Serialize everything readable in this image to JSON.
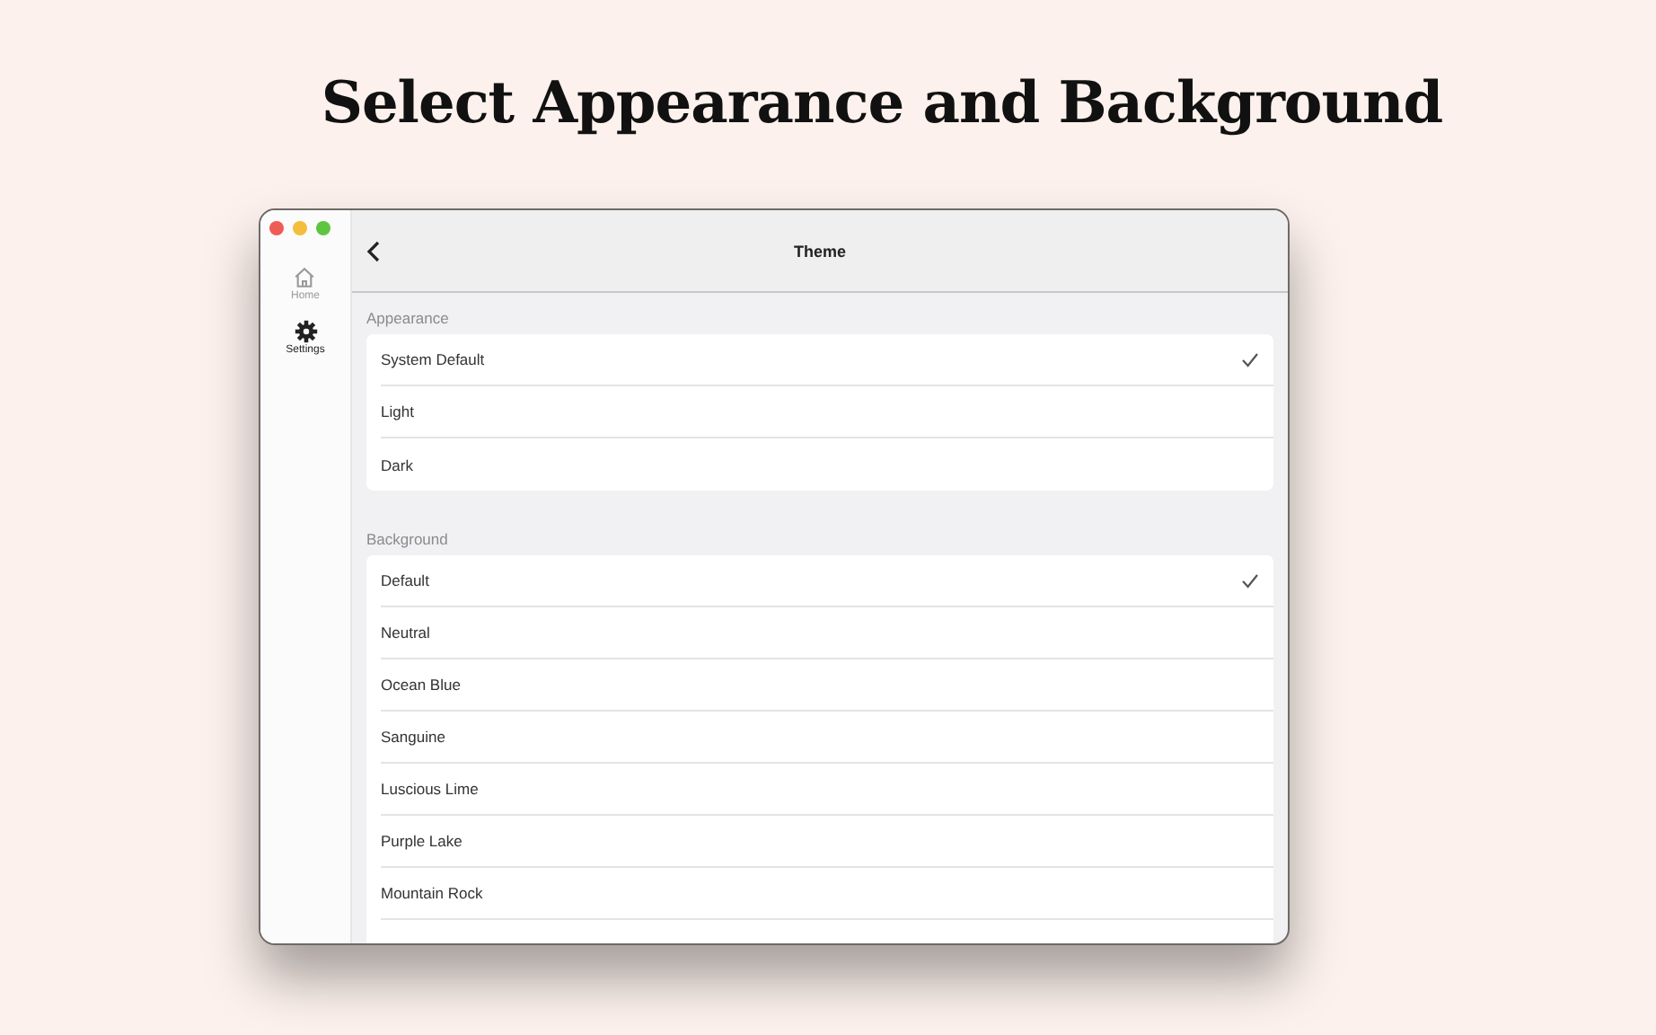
{
  "headline": "Select Appearance and Background",
  "sidebar": {
    "items": [
      {
        "label": "Home",
        "selected": false,
        "kind": "home"
      },
      {
        "label": "Settings",
        "selected": true,
        "kind": "gear"
      }
    ]
  },
  "header": {
    "title": "Theme"
  },
  "sections": [
    {
      "title": "Appearance",
      "options": [
        {
          "label": "System Default",
          "selected": true
        },
        {
          "label": "Light",
          "selected": false
        },
        {
          "label": "Dark",
          "selected": false
        }
      ]
    },
    {
      "title": "Background",
      "options": [
        {
          "label": "Default",
          "selected": true
        },
        {
          "label": "Neutral",
          "selected": false
        },
        {
          "label": "Ocean Blue",
          "selected": false
        },
        {
          "label": "Sanguine",
          "selected": false
        },
        {
          "label": "Luscious Lime",
          "selected": false
        },
        {
          "label": "Purple Lake",
          "selected": false
        },
        {
          "label": "Mountain Rock",
          "selected": false
        }
      ]
    }
  ]
}
